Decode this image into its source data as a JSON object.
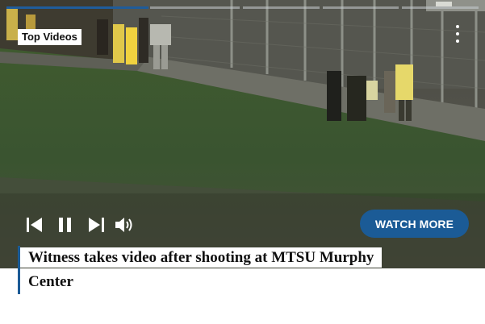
{
  "player": {
    "label": "Top Videos",
    "progress_fraction": 0.3,
    "controls": {
      "previous_icon": "skip-previous-icon",
      "pause_icon": "pause-icon",
      "next_icon": "skip-next-icon",
      "volume_icon": "volume-icon"
    },
    "watch_more_label": "WATCH MORE",
    "menu_icon": "more-vertical-icon"
  },
  "caption": {
    "title": "Witness takes video after shooting at MTSU Murphy Center"
  },
  "colors": {
    "accent": "#1b5b96",
    "caption_text": "#111111"
  }
}
